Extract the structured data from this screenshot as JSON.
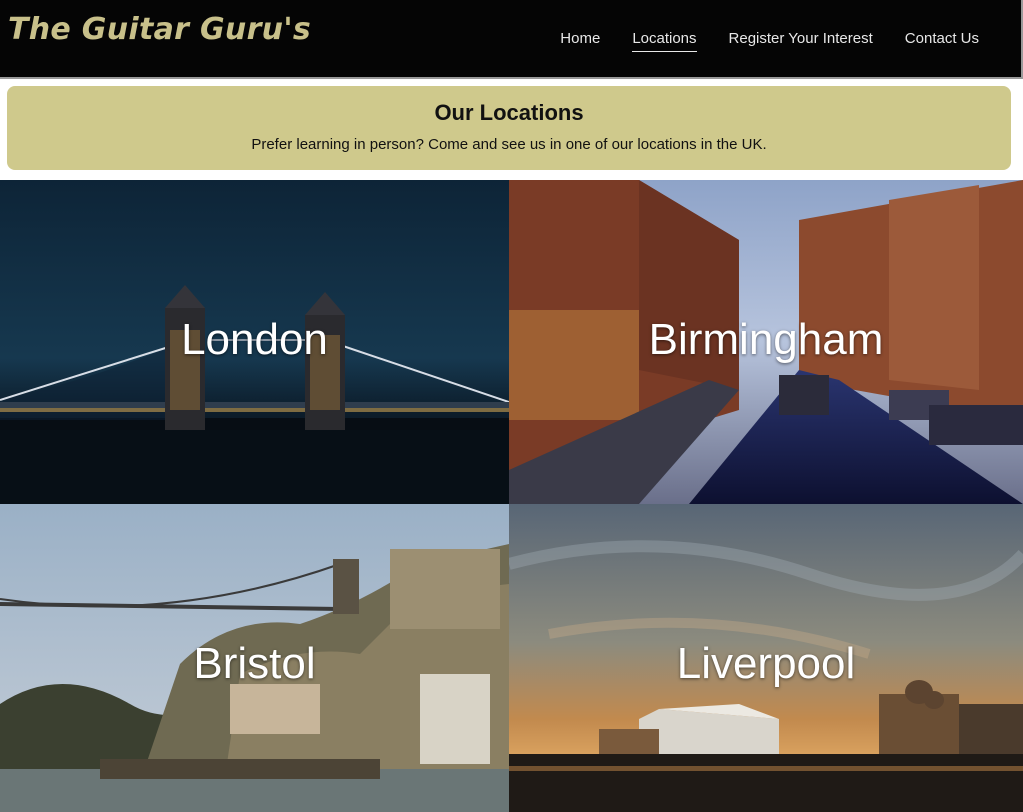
{
  "header": {
    "brand": "The Guitar Guru's",
    "brand_color": "#c8c08a",
    "nav": [
      {
        "label": "Home",
        "active": false
      },
      {
        "label": "Locations",
        "active": true
      },
      {
        "label": "Register Your Interest",
        "active": false
      },
      {
        "label": "Contact Us",
        "active": false
      }
    ]
  },
  "banner": {
    "title": "Our Locations",
    "subtitle": "Prefer learning in person? Come and see us in one of our locations in the UK.",
    "background_color": "#cfc98c"
  },
  "locations": [
    {
      "name": "London",
      "image": "tower-bridge-night"
    },
    {
      "name": "Birmingham",
      "image": "canal-dusk"
    },
    {
      "name": "Bristol",
      "image": "suspension-bridge-river"
    },
    {
      "name": "Liverpool",
      "image": "waterfront-sunset"
    }
  ]
}
